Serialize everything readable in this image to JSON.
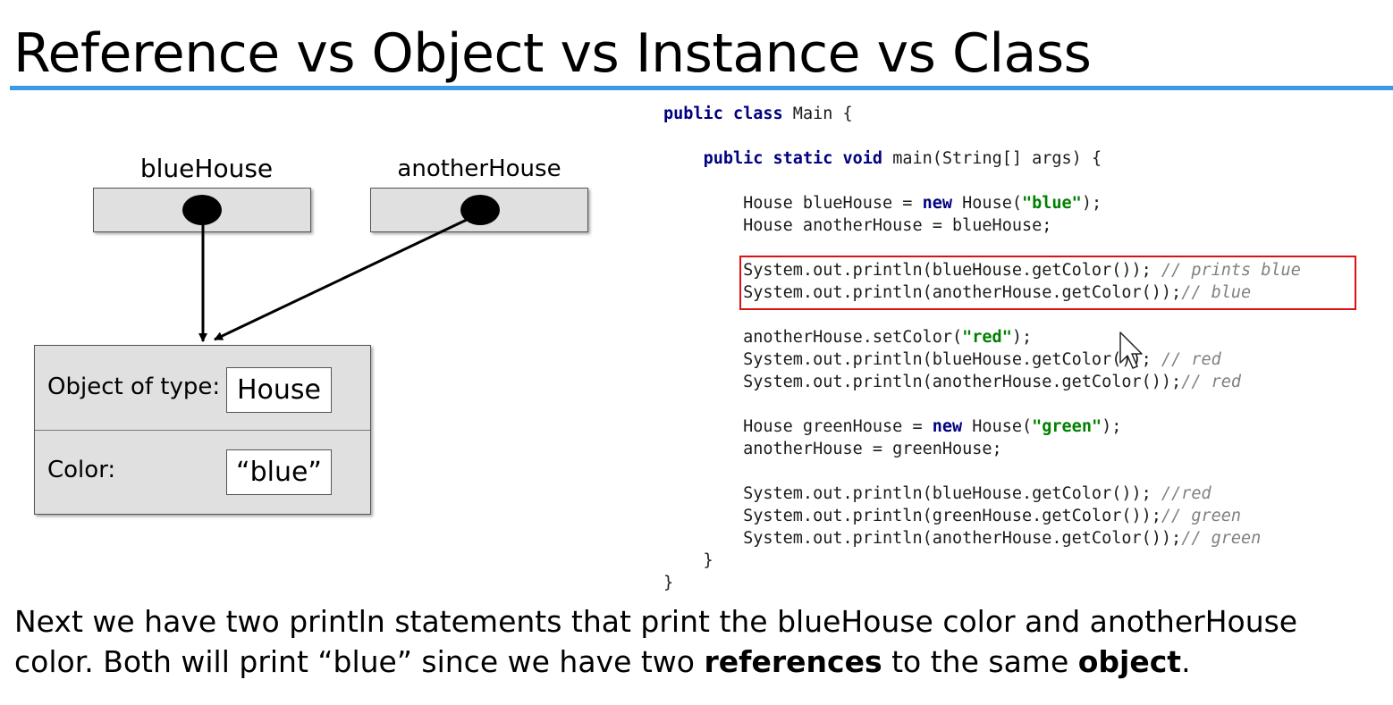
{
  "slide": {
    "title": "Reference vs Object vs Instance vs Class",
    "accent_color": "#3a9ae8"
  },
  "diagram": {
    "references": [
      {
        "name": "blueHouse"
      },
      {
        "name": "anotherHouse"
      }
    ],
    "object": {
      "type_label": "Object of type:",
      "type_value": "House",
      "color_label": "Color:",
      "color_value": "“blue”"
    }
  },
  "code": {
    "lines": [
      [
        {
          "t": "kw",
          "v": "public"
        },
        {
          "t": "",
          "v": " "
        },
        {
          "t": "kw",
          "v": "class"
        },
        {
          "t": "",
          "v": " Main {"
        }
      ],
      [],
      [
        {
          "t": "",
          "v": "    "
        },
        {
          "t": "kw",
          "v": "public"
        },
        {
          "t": "",
          "v": " "
        },
        {
          "t": "kw",
          "v": "static"
        },
        {
          "t": "",
          "v": " "
        },
        {
          "t": "kw",
          "v": "void"
        },
        {
          "t": "",
          "v": " main(String[] args) {"
        }
      ],
      [],
      [
        {
          "t": "",
          "v": "        House blueHouse = "
        },
        {
          "t": "kw",
          "v": "new"
        },
        {
          "t": "",
          "v": " House("
        },
        {
          "t": "str",
          "v": "\"blue\""
        },
        {
          "t": "",
          "v": ");"
        }
      ],
      [
        {
          "t": "",
          "v": "        House anotherHouse = blueHouse;"
        }
      ],
      [],
      [
        {
          "t": "",
          "v": "        System.out.println(blueHouse.getColor()); "
        },
        {
          "t": "cm",
          "v": "// prints blue"
        }
      ],
      [
        {
          "t": "",
          "v": "        System.out.println(anotherHouse.getColor());"
        },
        {
          "t": "cm",
          "v": "// blue"
        }
      ],
      [],
      [
        {
          "t": "",
          "v": "        anotherHouse.setColor("
        },
        {
          "t": "str",
          "v": "\"red\""
        },
        {
          "t": "",
          "v": ");"
        }
      ],
      [
        {
          "t": "",
          "v": "        System.out.println(blueHouse.getColor()); "
        },
        {
          "t": "cm",
          "v": "// red"
        }
      ],
      [
        {
          "t": "",
          "v": "        System.out.println(anotherHouse.getColor());"
        },
        {
          "t": "cm",
          "v": "// red"
        }
      ],
      [],
      [
        {
          "t": "",
          "v": "        House greenHouse = "
        },
        {
          "t": "kw",
          "v": "new"
        },
        {
          "t": "",
          "v": " House("
        },
        {
          "t": "str",
          "v": "\"green\""
        },
        {
          "t": "",
          "v": ");"
        }
      ],
      [
        {
          "t": "",
          "v": "        anotherHouse = greenHouse;"
        }
      ],
      [],
      [
        {
          "t": "",
          "v": "        System.out.println(blueHouse.getColor()); "
        },
        {
          "t": "cm",
          "v": "//red"
        }
      ],
      [
        {
          "t": "",
          "v": "        System.out.println(greenHouse.getColor());"
        },
        {
          "t": "cm",
          "v": "// green"
        }
      ],
      [
        {
          "t": "",
          "v": "        System.out.println(anotherHouse.getColor());"
        },
        {
          "t": "cm",
          "v": "// green"
        }
      ],
      [
        {
          "t": "",
          "v": "    }"
        }
      ],
      [
        {
          "t": "",
          "v": "}"
        }
      ]
    ],
    "highlight_color": "#dd1111"
  },
  "caption": {
    "part1": "Next we have two println statements that print the blueHouse color and anotherHouse color. Both will print “blue” since we have two ",
    "bold1": "references",
    "part2": " to the same ",
    "bold2": "object",
    "part3": "."
  }
}
